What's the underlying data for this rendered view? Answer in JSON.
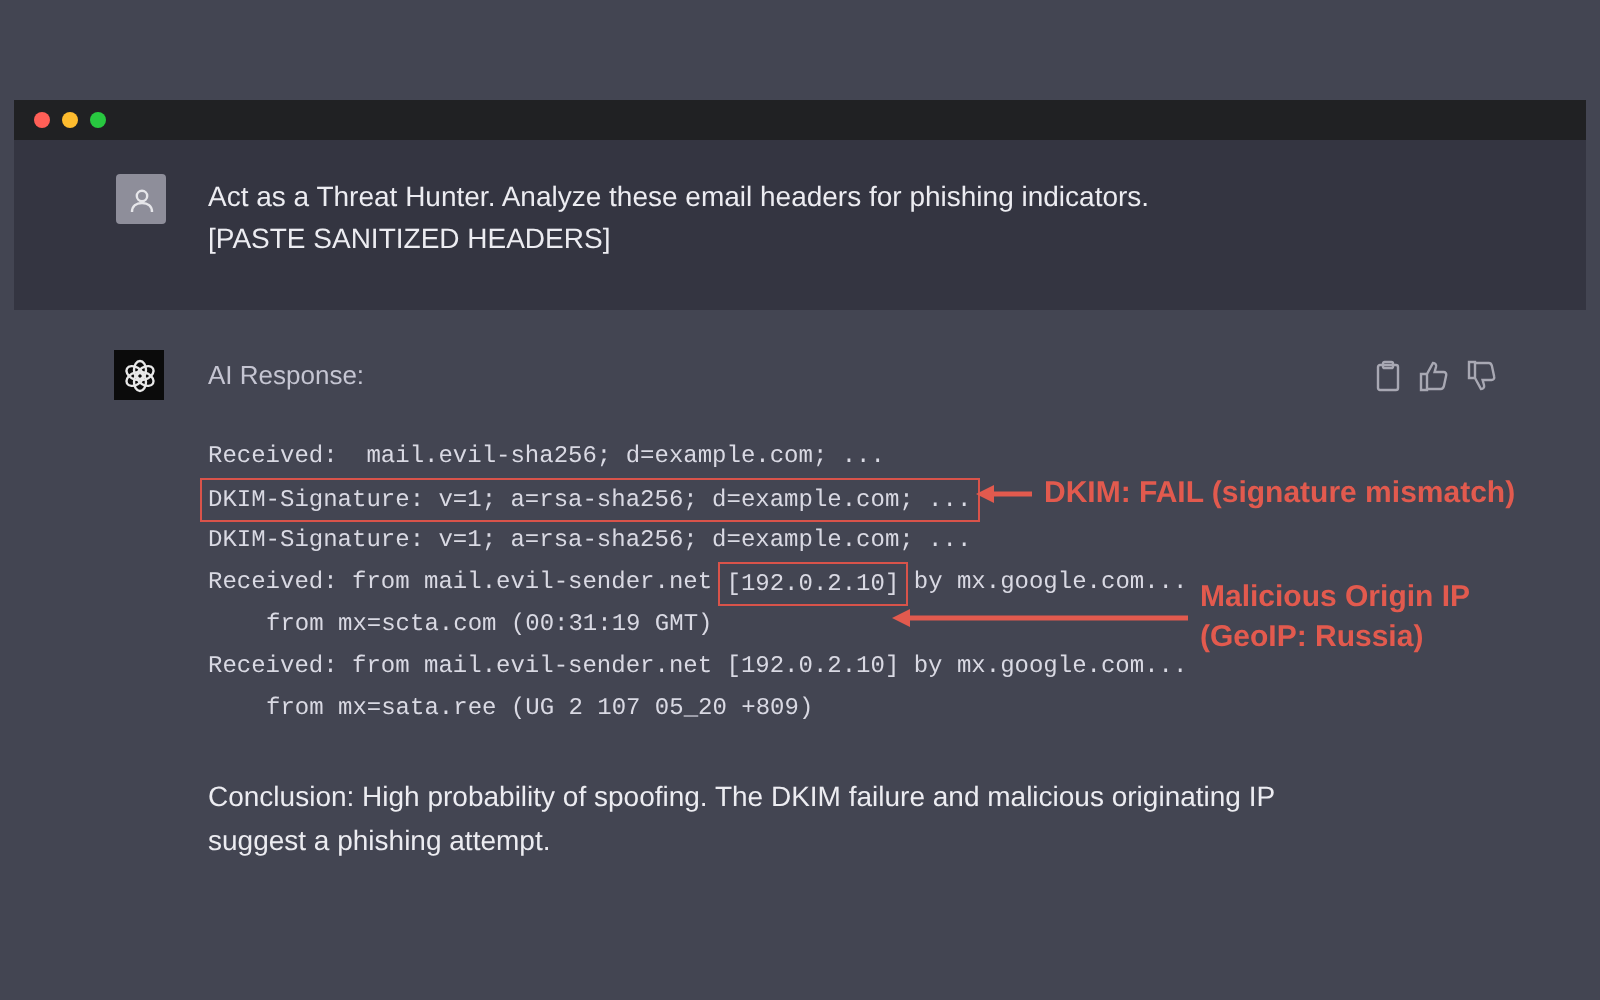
{
  "prompt": {
    "lines": [
      "Act as a Threat Hunter. Analyze these email headers for phishing indicators.",
      "[PASTE SANITIZED HEADERS]"
    ]
  },
  "response": {
    "label": "AI Response:",
    "code_lines": [
      {
        "kind": "header",
        "segments": [
          {
            "text": "Received:  mail.evil-sha256; d=example.com; ...",
            "boxed": false
          }
        ]
      },
      {
        "kind": "header",
        "segments": [
          {
            "text": "DKIM-Signature: v=1; a=rsa-sha256; d=example.com; ...",
            "boxed": true
          }
        ]
      },
      {
        "kind": "header",
        "segments": [
          {
            "text": "DKIM-Signature: v=1; a=rsa-sha256; d=example.com; ...",
            "boxed": false
          }
        ]
      },
      {
        "kind": "header",
        "segments": [
          {
            "text": "Received: from mail.evil-sender.net ",
            "boxed": false
          },
          {
            "text": "[192.0.2.10]",
            "boxed": true
          },
          {
            "text": " by mx.google.com...",
            "boxed": false
          }
        ]
      },
      {
        "kind": "continuation",
        "segments": [
          {
            "text": "from mx=scta.com (00:31:19 GMT)",
            "boxed": false
          }
        ]
      },
      {
        "kind": "header",
        "segments": [
          {
            "text": "Received: from mail.evil-sender.net [192.0.2.10] by mx.google.com...",
            "boxed": false
          }
        ]
      },
      {
        "kind": "continuation",
        "segments": [
          {
            "text": "from mx=sata.ree (UG 2 107 05_20 +809)",
            "boxed": false
          }
        ]
      }
    ],
    "callouts": [
      {
        "lines": [
          "DKIM: FAIL (signature mismatch)"
        ]
      },
      {
        "lines": [
          "Malicious Origin IP",
          "(GeoIP: Russia)"
        ]
      }
    ],
    "conclusion": "Conclusion: High probability of spoofing. The DKIM failure and malicious originating IP suggest a phishing attempt."
  }
}
